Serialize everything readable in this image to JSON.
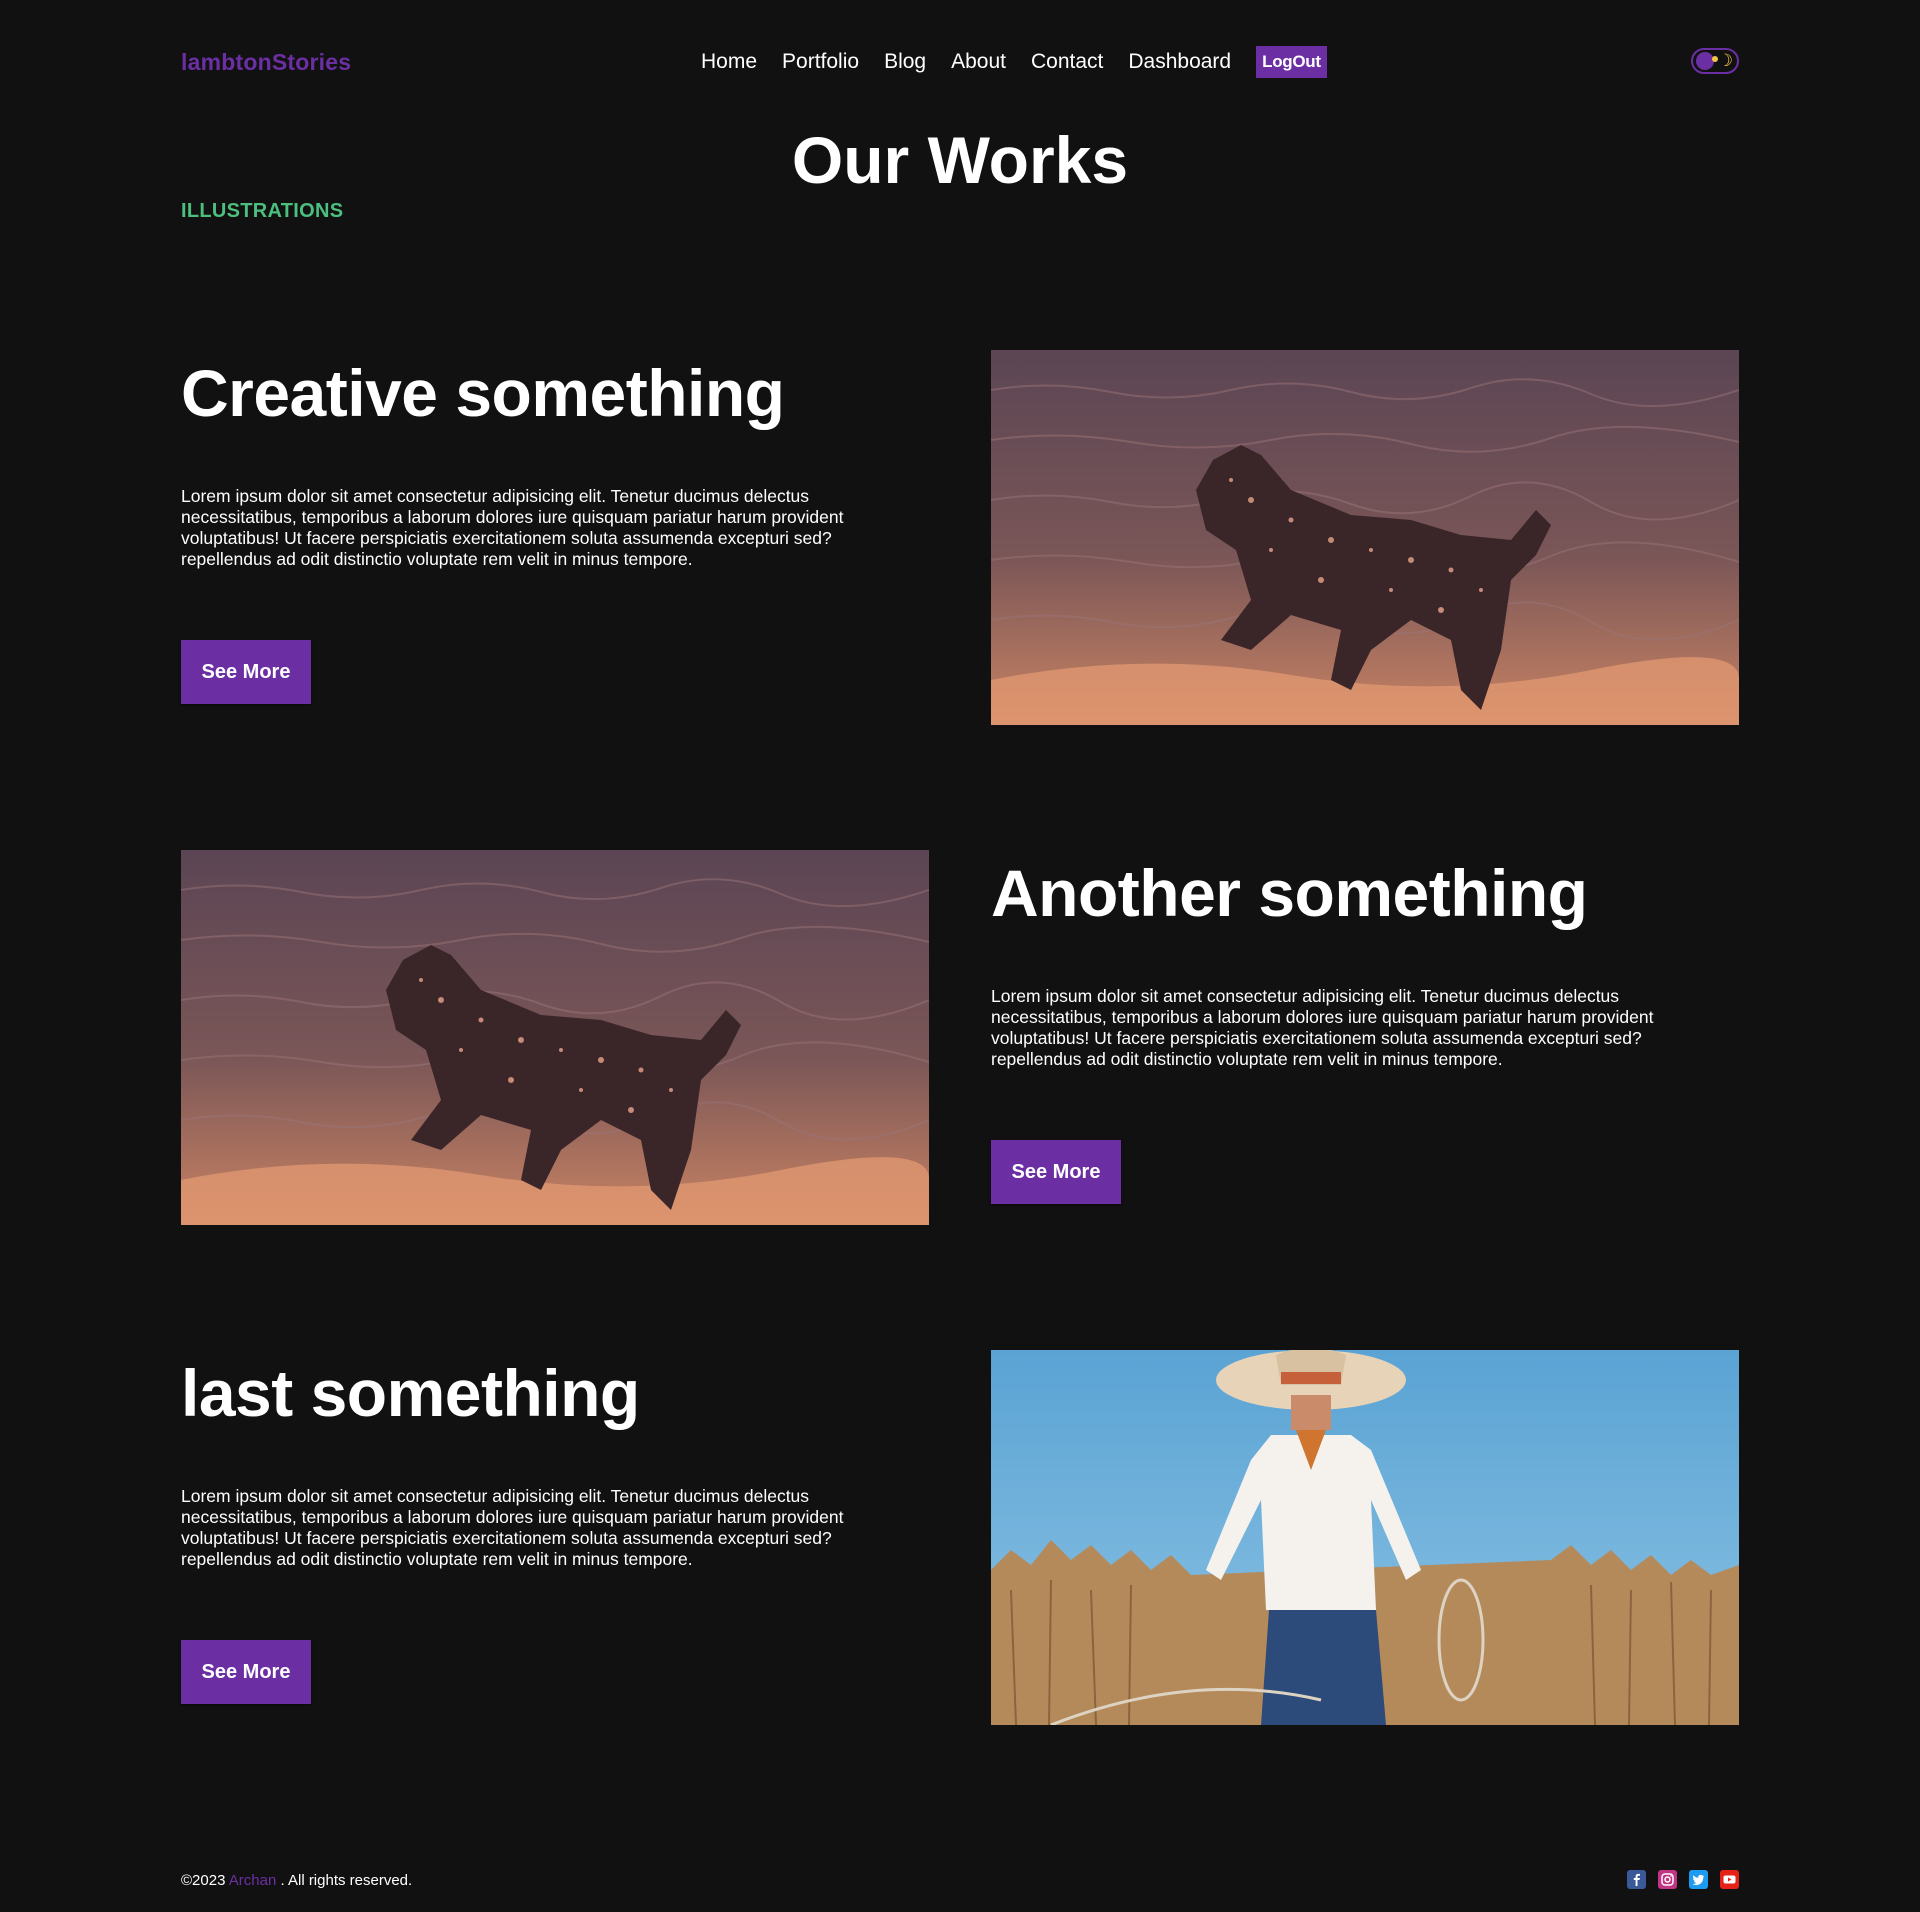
{
  "nav": {
    "logo": "lambtonStories",
    "links": [
      "Home",
      "Portfolio",
      "Blog",
      "About",
      "Contact",
      "Dashboard"
    ],
    "logout_label": "LogOut",
    "theme_moon_glyph": "☽"
  },
  "page": {
    "title": "Our Works",
    "category": "ILLUSTRATIONS"
  },
  "works": [
    {
      "title": "Creative something",
      "description": "Lorem ipsum dolor sit amet consectetur adipisicing elit. Tenetur ducimus delectus necessitatibus, temporibus a laborum dolores iure quisquam pariatur harum provident voluptatibus! Ut facere perspiciatis exercitationem soluta assumenda excepturi sed? repellendus ad odit distinctio voluptate rem velit in minus tempore.",
      "button_label": "See More",
      "image": "dog-running-in-water-photo"
    },
    {
      "title": "Another something",
      "description": "Lorem ipsum dolor sit amet consectetur adipisicing elit. Tenetur ducimus delectus necessitatibus, temporibus a laborum dolores iure quisquam pariatur harum provident voluptatibus! Ut facere perspiciatis exercitationem soluta assumenda excepturi sed? repellendus ad odit distinctio voluptate rem velit in minus tempore.",
      "button_label": "See More",
      "image": "dog-running-in-water-photo"
    },
    {
      "title": "last something",
      "description": "Lorem ipsum dolor sit amet consectetur adipisicing elit. Tenetur ducimus delectus necessitatibus, temporibus a laborum dolores iure quisquam pariatur harum provident voluptatibus! Ut facere perspiciatis exercitationem soluta assumenda excepturi sed? repellendus ad odit distinctio voluptate rem velit in minus tempore.",
      "button_label": "See More",
      "image": "cowboy-with-lasso-in-field-photo"
    }
  ],
  "footer": {
    "copyright_prefix": "©2023",
    "author": "Archan",
    "copyright_suffix": ". All rights reserved.",
    "social_icons": [
      "facebook-icon",
      "instagram-icon",
      "twitter-icon",
      "youtube-icon"
    ]
  },
  "colors": {
    "background": "#111111",
    "accent": "#6b2fa3",
    "category": "#4cbf7f",
    "text": "#ffffff"
  }
}
